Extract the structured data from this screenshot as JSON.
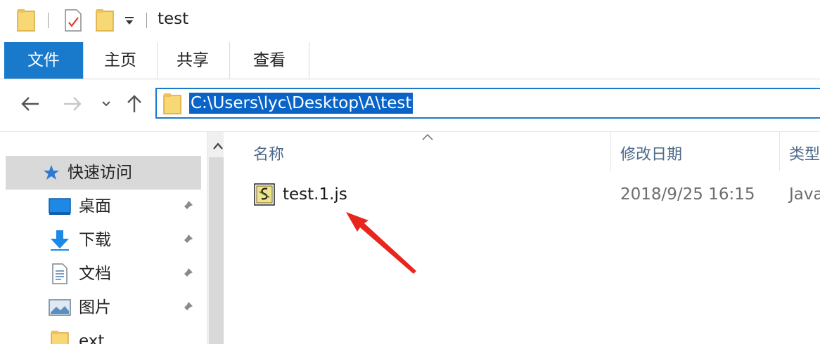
{
  "window": {
    "title": "test"
  },
  "ribbon": {
    "tabs": [
      {
        "label": "文件",
        "active": true
      },
      {
        "label": "主页"
      },
      {
        "label": "共享"
      },
      {
        "label": "查看"
      }
    ]
  },
  "address_bar": {
    "path": "C:\\Users\\lyc\\Desktop\\A\\test"
  },
  "nav_pane": {
    "items": [
      {
        "label": "快速访问",
        "icon": "star-icon",
        "selected": true
      },
      {
        "label": "桌面",
        "icon": "desktop-icon",
        "pinned": true
      },
      {
        "label": "下载",
        "icon": "download-icon",
        "pinned": true
      },
      {
        "label": "文档",
        "icon": "document-icon",
        "pinned": true
      },
      {
        "label": "图片",
        "icon": "picture-icon",
        "pinned": true
      },
      {
        "label": "ext",
        "icon": "folder-icon"
      }
    ]
  },
  "file_list": {
    "columns": {
      "name": "名称",
      "modified": "修改日期",
      "type": "类型"
    },
    "rows": [
      {
        "name": "test.1.js",
        "modified": "2018/9/25 16:15",
        "type": "Java"
      }
    ]
  },
  "colors": {
    "accent": "#1979ca",
    "selection": "#0a64c8",
    "annotation_arrow": "#e8261e"
  }
}
